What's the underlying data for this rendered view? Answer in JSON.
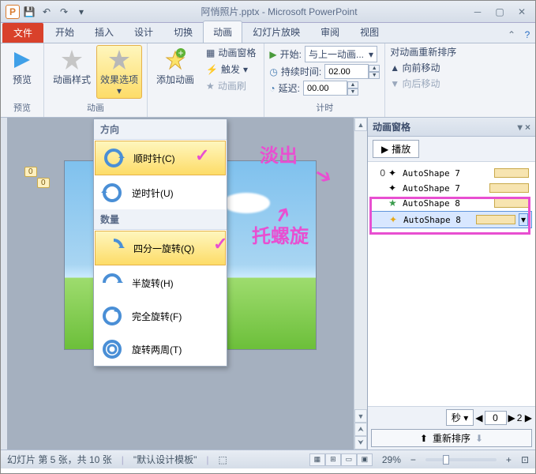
{
  "window": {
    "title": "阿悄照片.pptx - Microsoft PowerPoint"
  },
  "tabs": {
    "file": "文件",
    "start": "开始",
    "insert": "插入",
    "design": "设计",
    "transition": "切换",
    "animation": "动画",
    "slideshow": "幻灯片放映",
    "review": "审阅",
    "view": "视图"
  },
  "ribbon": {
    "preview": {
      "btn": "预览",
      "group": "预览"
    },
    "style": "动画样式",
    "effect": "效果选项",
    "add": "添加动画",
    "animgroup": "动画",
    "pane": "动画窗格",
    "trigger": "触发",
    "painter": "动画刷",
    "start": "开始:",
    "startval": "与上一动画...",
    "duration": "持续时间:",
    "durval": "02.00",
    "delay": "延迟:",
    "delayval": "00.00",
    "timing": "计时",
    "reorderlbl": "对动画重新排序",
    "fwd": "向前移动",
    "back": "向后移动"
  },
  "dropdown": {
    "h1": "方向",
    "cw": "顺时针(C)",
    "ccw": "逆时针(U)",
    "h2": "数量",
    "q": "四分一旋转(Q)",
    "h": "半旋转(H)",
    "f": "完全旋转(F)",
    "t": "旋转两周(T)"
  },
  "anno": {
    "fadeout": "淡出",
    "spin": "托螺旋"
  },
  "pane": {
    "title": "动画窗格",
    "play": "播放",
    "items": [
      {
        "n": "0",
        "name": "AutoShape 7"
      },
      {
        "n": "",
        "name": "AutoShape 7"
      },
      {
        "n": "",
        "name": "AutoShape 8"
      },
      {
        "n": "",
        "name": "AutoShape 8"
      }
    ],
    "sec": "秒",
    "secv": "0",
    "reorder": "重新排序"
  },
  "status": {
    "slide": "幻灯片 第 5 张，共 10 张",
    "tpl": "\"默认设计模板\"",
    "zoom": "29%"
  }
}
